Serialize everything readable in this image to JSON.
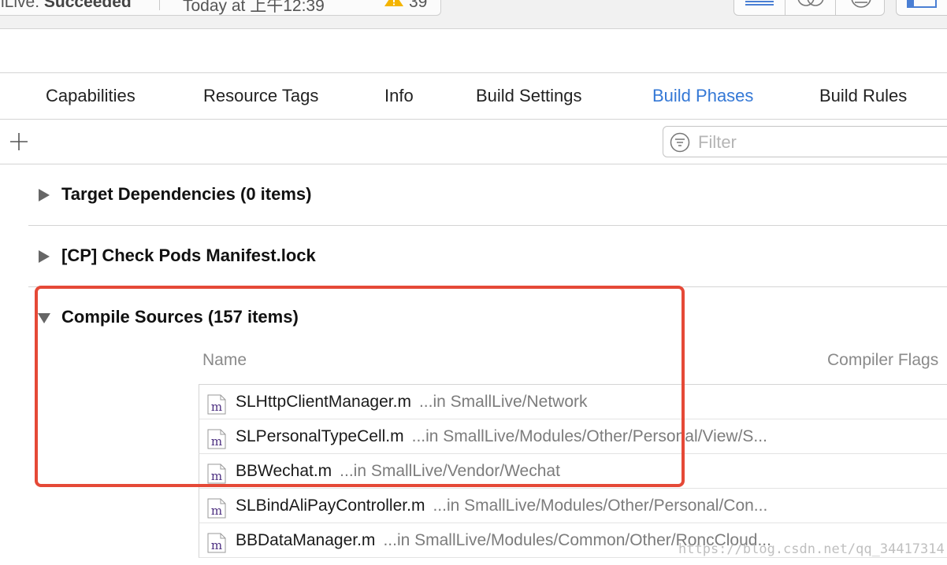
{
  "toolbar": {
    "scheme": "lLive:",
    "build_state": "Succeeded",
    "time": "Today at 上午12:39",
    "warning_count": "39",
    "warning_color": "#f4b400"
  },
  "tabs": [
    {
      "label": "Capabilities",
      "active": false
    },
    {
      "label": "Resource Tags",
      "active": false
    },
    {
      "label": "Info",
      "active": false
    },
    {
      "label": "Build Settings",
      "active": false
    },
    {
      "label": "Build Phases",
      "active": true
    },
    {
      "label": "Build Rules",
      "active": false
    }
  ],
  "filter": {
    "placeholder": "Filter",
    "value": ""
  },
  "phases": [
    {
      "title": "Target Dependencies (0 items)",
      "expanded": false
    },
    {
      "title": "[CP] Check Pods Manifest.lock",
      "expanded": false
    },
    {
      "title": "Compile Sources (157 items)",
      "expanded": true
    }
  ],
  "compile_sources": {
    "columns": {
      "name": "Name",
      "flags": "Compiler Flags"
    },
    "files": [
      {
        "name": "SLHttpClientManager.m",
        "path": "...in SmallLive/Network"
      },
      {
        "name": "SLPersonalTypeCell.m",
        "path": "...in SmallLive/Modules/Other/Personal/View/S..."
      },
      {
        "name": "BBWechat.m",
        "path": "...in SmallLive/Vendor/Wechat"
      },
      {
        "name": "SLBindAliPayController.m",
        "path": "...in SmallLive/Modules/Other/Personal/Con..."
      },
      {
        "name": "BBDataManager.m",
        "path": "...in SmallLive/Modules/Common/Other/RoncCloud..."
      }
    ]
  },
  "colors": {
    "accent": "#3478d6",
    "annotation": "#e54937",
    "file_icon": "#4b2d7f"
  },
  "watermark": "https://blog.csdn.net/qq_34417314"
}
